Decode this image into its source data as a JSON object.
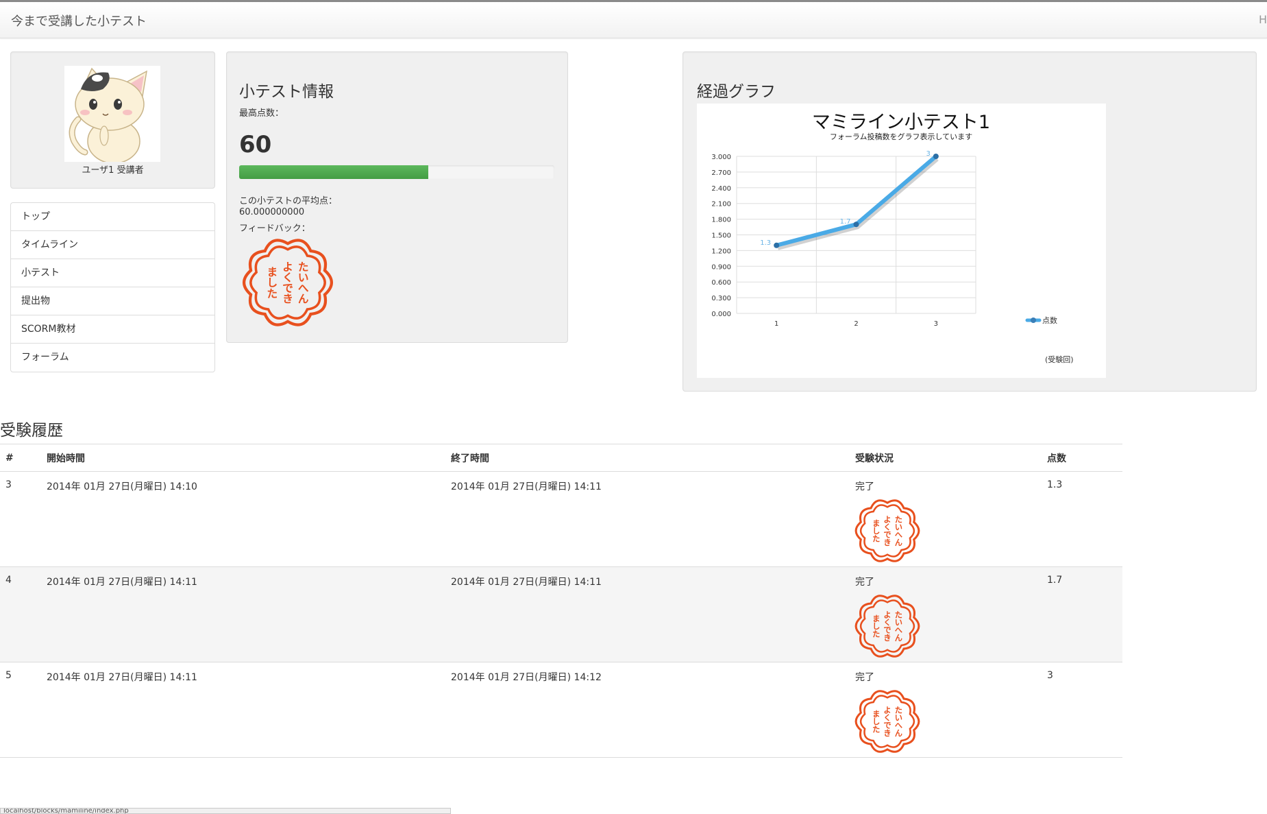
{
  "header": {
    "title": "今まで受講した小テスト",
    "edge_text": "H"
  },
  "profile": {
    "name": "ユーザ1 受講者"
  },
  "nav": {
    "items": [
      {
        "label": "トップ"
      },
      {
        "label": "タイムライン"
      },
      {
        "label": "小テスト"
      },
      {
        "label": "提出物"
      },
      {
        "label": "SCORM教材"
      },
      {
        "label": "フォーラム"
      }
    ]
  },
  "quiz_info": {
    "heading": "小テスト情報",
    "max_label": "最高点数：",
    "max_value": "60",
    "progress_fraction": 0.6,
    "avg_label": "この小テストの平均点：",
    "avg_value": "60.000000000",
    "feedback_label": "フィードバック："
  },
  "stamp": {
    "lines": [
      "たいへん",
      "よくでき",
      "ました"
    ],
    "color": "#e8501e"
  },
  "graph": {
    "heading": "経過グラフ"
  },
  "chart_data": {
    "type": "line",
    "title": "マミライン小テスト1",
    "subtitle": "フォーラム投稿数をグラフ表示しています",
    "x": [
      1,
      2,
      3
    ],
    "xlabel": "(受験回)",
    "ylim": [
      0,
      3.0
    ],
    "yticks": [
      "0.000",
      "0.300",
      "0.600",
      "0.900",
      "1.200",
      "1.500",
      "1.800",
      "2.100",
      "2.400",
      "2.700",
      "3.000"
    ],
    "series": [
      {
        "name": "点数",
        "values": [
          1.3,
          1.7,
          3
        ],
        "labels": [
          "1.3",
          "1.7",
          "3"
        ],
        "color": "#4aaae6"
      }
    ],
    "grid": true,
    "legend": "right"
  },
  "history": {
    "title": "受験履歴",
    "columns": [
      "#",
      "開始時間",
      "終了時間",
      "受験状況",
      "点数"
    ],
    "rows": [
      {
        "num": "3",
        "start": "2014年 01月 27日(月曜日) 14:10",
        "end": "2014年 01月 27日(月曜日) 14:11",
        "status": "完了",
        "score": "1.3"
      },
      {
        "num": "4",
        "start": "2014年 01月 27日(月曜日) 14:11",
        "end": "2014年 01月 27日(月曜日) 14:11",
        "status": "完了",
        "score": "1.7"
      },
      {
        "num": "5",
        "start": "2014年 01月 27日(月曜日) 14:11",
        "end": "2014年 01月 27日(月曜日) 14:12",
        "status": "完了",
        "score": "3"
      }
    ]
  },
  "statusbar": {
    "text": "localhost/blocks/mamiline/index.php"
  }
}
